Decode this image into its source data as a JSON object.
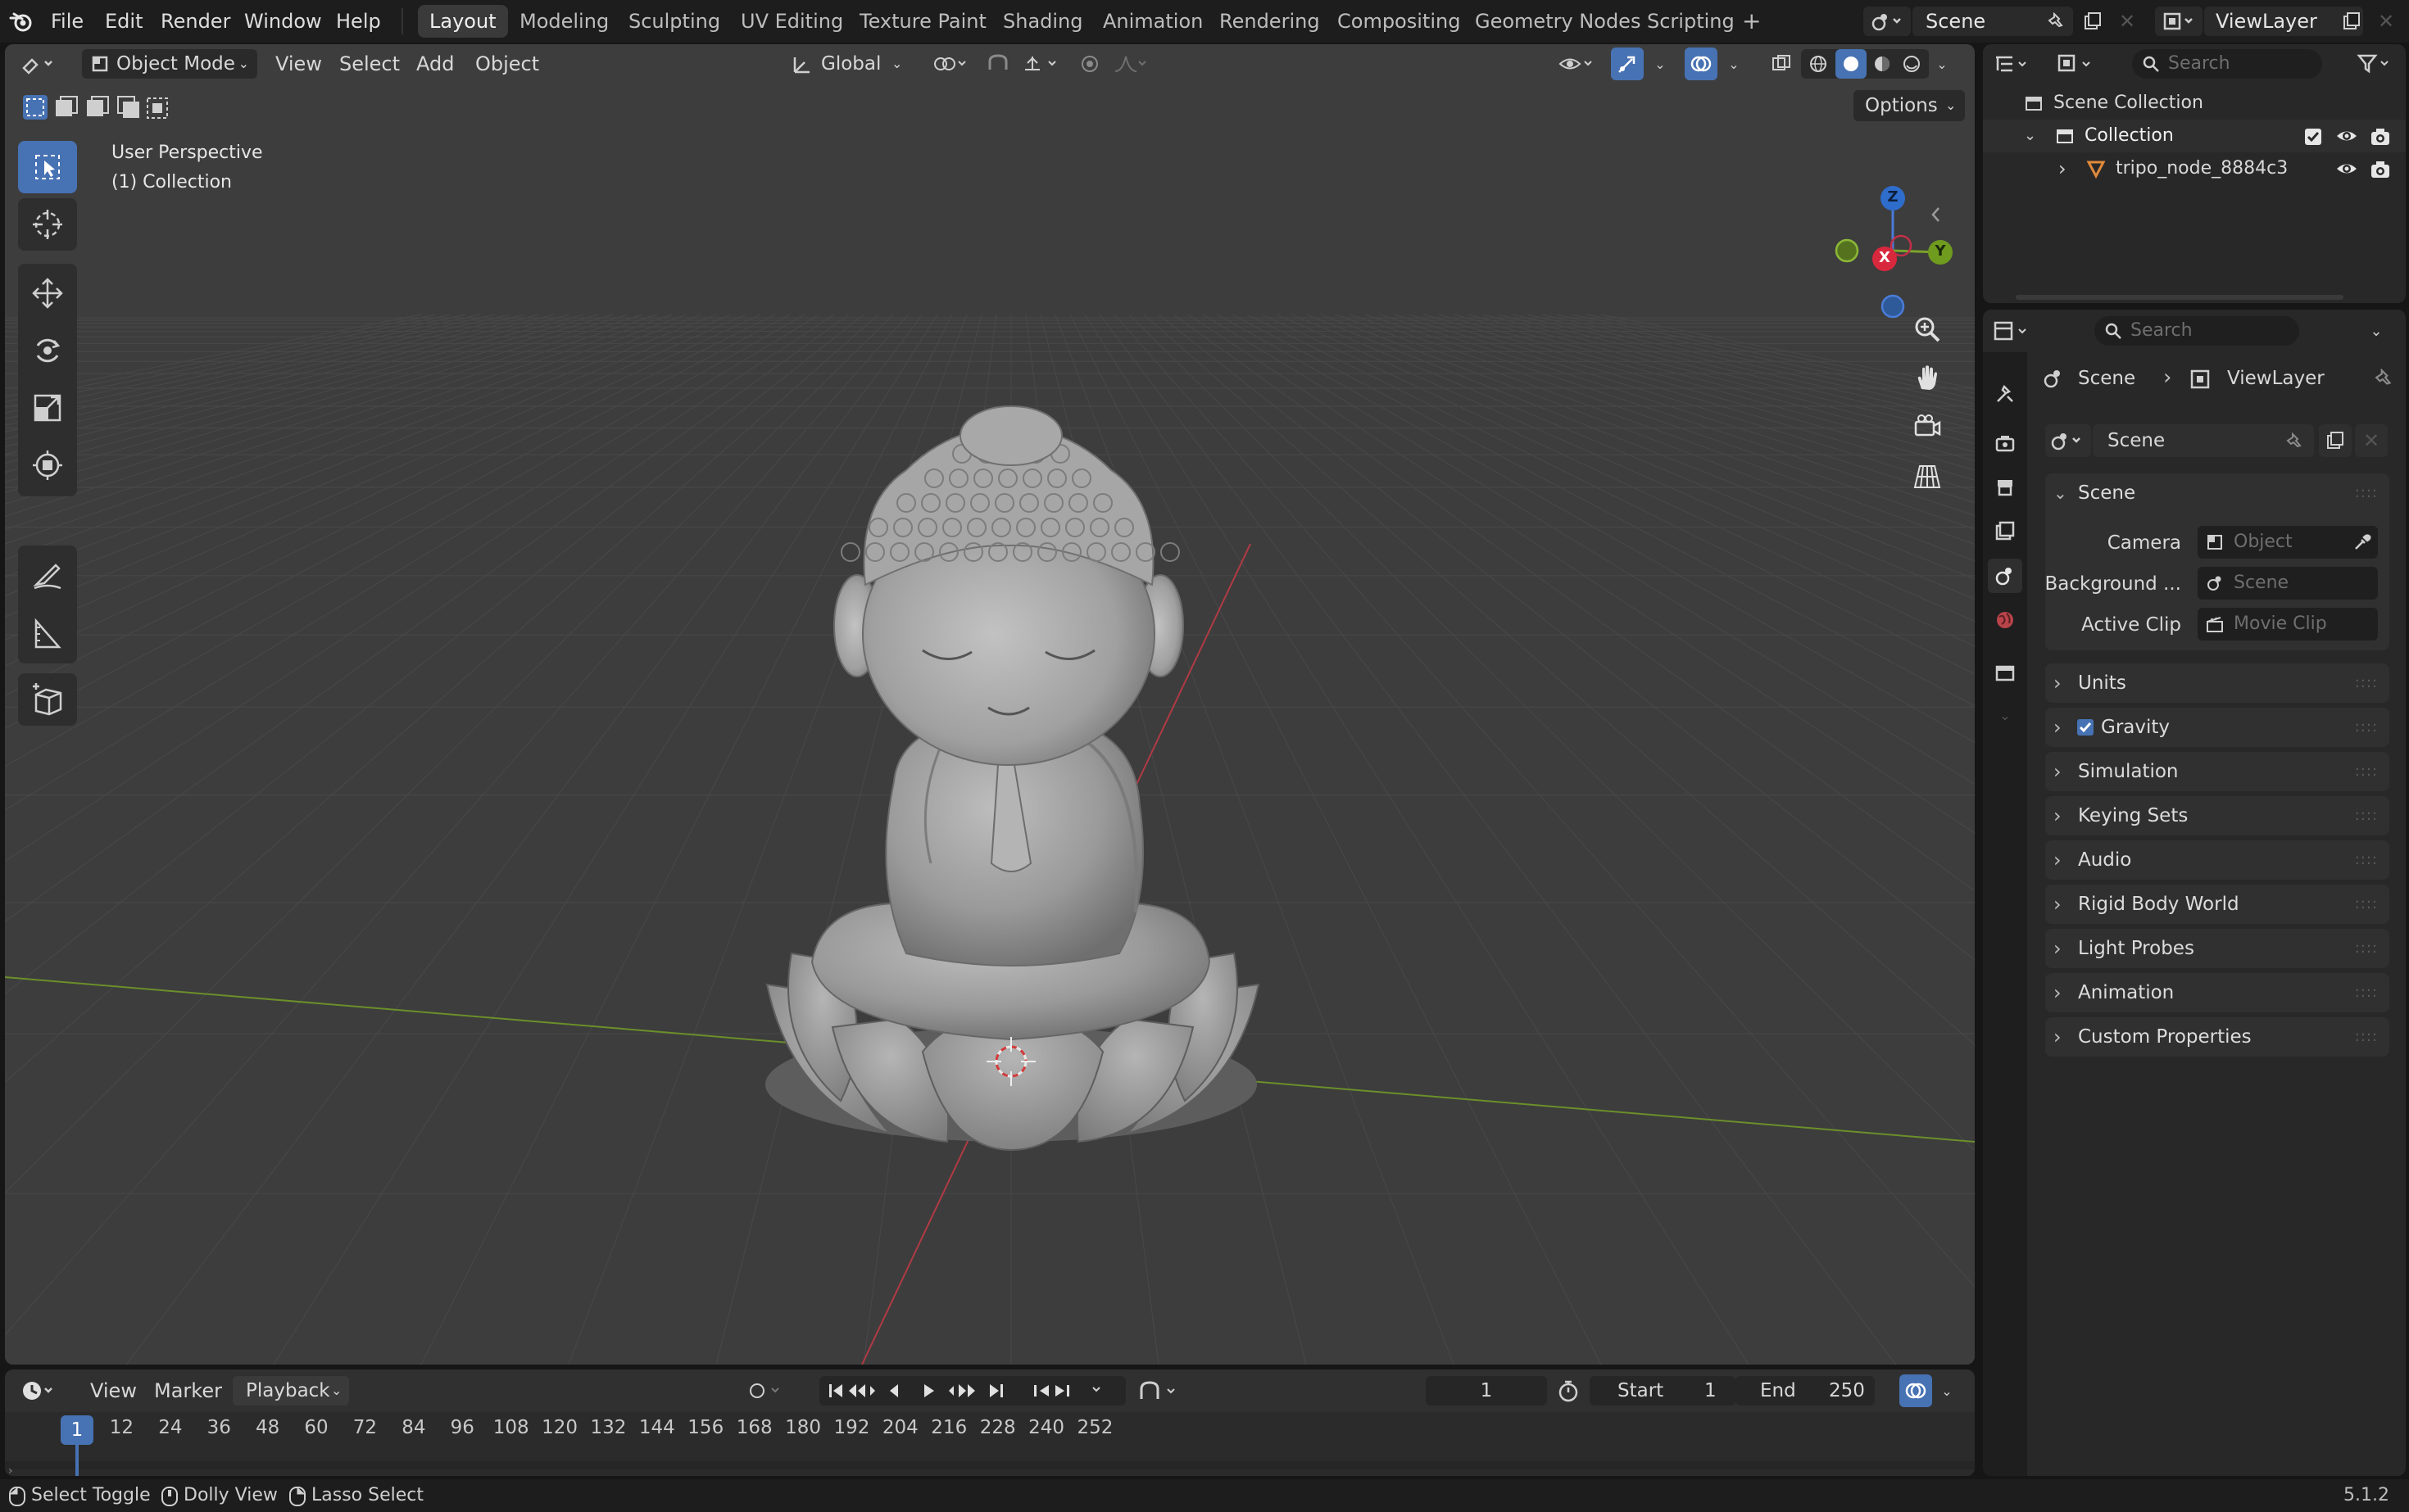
{
  "topbar": {
    "menus": [
      "File",
      "Edit",
      "Render",
      "Window",
      "Help"
    ],
    "workspaces": [
      "Layout",
      "Modeling",
      "Sculpting",
      "UV Editing",
      "Texture Paint",
      "Shading",
      "Animation",
      "Rendering",
      "Compositing",
      "Geometry Nodes",
      "Scripting"
    ],
    "active_workspace": "Layout",
    "add_workspace": "+",
    "scene_name": "Scene",
    "view_layer_name": "ViewLayer"
  },
  "viewport": {
    "mode": "Object Mode",
    "menus": [
      "View",
      "Select",
      "Add",
      "Object"
    ],
    "transform_orientation": "Global",
    "options_label": "Options",
    "overlay_text_1": "User Perspective",
    "overlay_text_2": "(1) Collection",
    "gizmo": {
      "x": "X",
      "y": "Y",
      "z": "Z"
    },
    "accent": "#4772b3"
  },
  "timeline": {
    "menus": [
      "View",
      "Marker",
      "Playback"
    ],
    "current_frame": "1",
    "start_label": "Start",
    "start_value": "1",
    "end_label": "End",
    "end_value": "250",
    "ruler": [
      "12",
      "24",
      "36",
      "48",
      "60",
      "72",
      "84",
      "96",
      "108",
      "120",
      "132",
      "144",
      "156",
      "168",
      "180",
      "192",
      "204",
      "216",
      "228",
      "240",
      "252"
    ],
    "playhead": "1"
  },
  "statusbar": {
    "hints": [
      "Select Toggle",
      "Dolly View",
      "Lasso Select"
    ],
    "version": "5.1.2"
  },
  "outliner": {
    "search_placeholder": "Search",
    "scene_collection": "Scene Collection",
    "collection": "Collection",
    "object": "tripo_node_8884c3("
  },
  "properties": {
    "search_placeholder": "Search",
    "breadcrumb_scene": "Scene",
    "breadcrumb_viewlayer": "ViewLayer",
    "datablock_name": "Scene",
    "scene_panel": {
      "title": "Scene",
      "camera_label": "Camera",
      "camera_placeholder": "Object",
      "background_label": "Background ...",
      "background_placeholder": "Scene",
      "active_clip_label": "Active Clip",
      "active_clip_placeholder": "Movie Clip"
    },
    "panels": [
      "Units",
      "Gravity",
      "Simulation",
      "Keying Sets",
      "Audio",
      "Rigid Body World",
      "Light Probes",
      "Animation",
      "Custom Properties"
    ],
    "gravity_enabled": true
  }
}
